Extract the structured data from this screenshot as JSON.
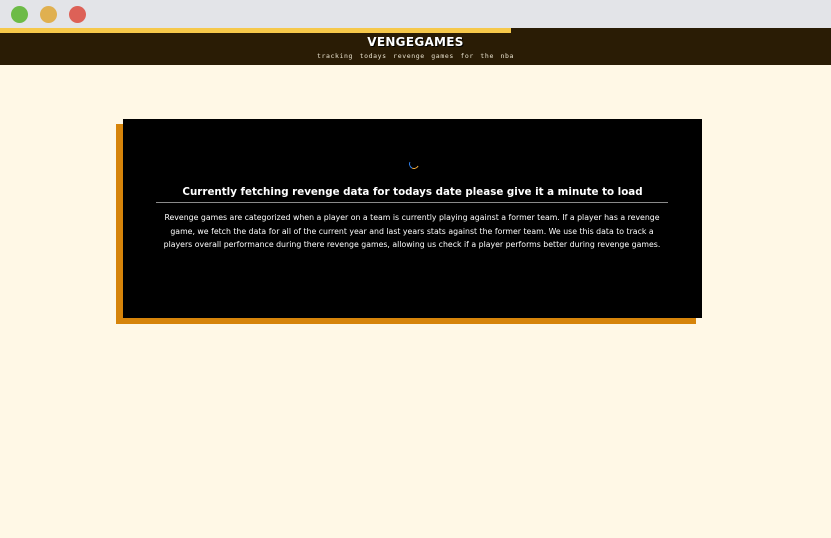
{
  "site": {
    "brand": "VENGEGAMES",
    "tagline": "tracking todays revenge games for the nba",
    "loading_progress_percent": 61.5
  },
  "card": {
    "title": "Currently fetching revenge data for todays date please give it a minute to load",
    "description": "Revenge games are categorized when a player on a team is currently playing against a former team. If a player has a revenge game, we fetch the data for all of the current year and last years stats against the former team. We use this data to track a players overall performance during there revenge games, allowing us check if a player performs better during revenge games."
  },
  "colors": {
    "page_background": "#fff8e6",
    "header_background": "#2a1c05",
    "progress": "#f6c84a",
    "card_background": "#000000",
    "card_shadow": "#d6840a",
    "window_close": "#dd6157",
    "window_minimize": "#e0b050",
    "window_maximize": "#6dbb47"
  },
  "icons": {
    "loading": "loading-spinner-icon"
  }
}
